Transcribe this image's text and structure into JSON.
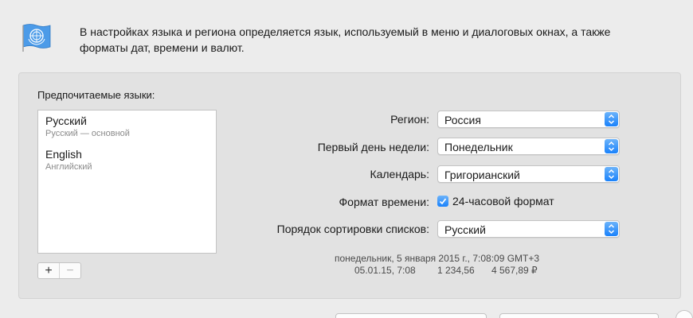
{
  "header": {
    "icon": "un-flag-icon",
    "description_line1": "В настройках языка и региона определяется язык, используемый в меню и диалоговых окнах, а также",
    "description_line2": "форматы дат, времени и валют."
  },
  "languages": {
    "label": "Предпочитаемые языки:",
    "items": [
      {
        "name": "Русский",
        "sub": "Русский — основной"
      },
      {
        "name": "English",
        "sub": "Английский"
      }
    ],
    "add_label": "+",
    "remove_label": "−"
  },
  "settings": {
    "region": {
      "label": "Регион:",
      "value": "Россия"
    },
    "first_day": {
      "label": "Первый день недели:",
      "value": "Понедельник"
    },
    "calendar": {
      "label": "Календарь:",
      "value": "Григорианский"
    },
    "time_format": {
      "label": "Формат времени:",
      "checkbox_label": "24-часовой формат",
      "checked": true
    },
    "sort_order": {
      "label": "Порядок сортировки списков:",
      "value": "Русский"
    }
  },
  "samples": {
    "line1": "понедельник, 5 января 2015 г., 7:08:09 GMT+3",
    "date": "05.01.15, 7:08",
    "number": "1 234,56",
    "currency": "4 567,89 ₽"
  },
  "colors": {
    "accent": "#1a82fb",
    "background": "#ececec",
    "panel": "#e2e2e2"
  }
}
